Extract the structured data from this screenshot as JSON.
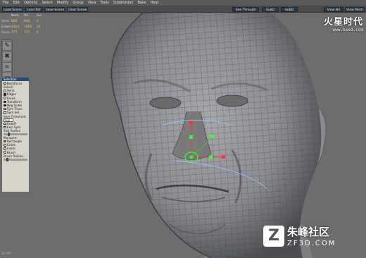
{
  "menu": [
    "File",
    "Edit",
    "Options",
    "Select",
    "Modify",
    "Group",
    "View",
    "Tools",
    "Subdivision",
    "Bake",
    "Help"
  ],
  "toolbar": {
    "load_scene": "Load Scene",
    "load_ref": "Load Ref",
    "save_scene": "Save Scene",
    "clear_scene": "Clear Scene",
    "see_through": "See Through",
    "subd": "SubD",
    "subd_mode": "SubD Mode",
    "view_nrl": "View Nrl",
    "view_mesh": "View Mesh"
  },
  "stats": {
    "headers": [
      "",
      "Num",
      "Vis",
      "Sel"
    ],
    "rows": [
      {
        "label": "Verts",
        "num": "602",
        "vis": "602",
        "sel": "0"
      },
      {
        "label": "Edges",
        "num": "1601",
        "vis": "1601",
        "sel": "24"
      },
      {
        "label": "Faces",
        "num": "777",
        "vis": "777",
        "sel": "6"
      }
    ]
  },
  "tools": [
    "paint-icon",
    "delete-x-icon",
    "link-icon",
    "folder-icon"
  ],
  "panel": {
    "title": "Selection",
    "backfaces": "Backfaces",
    "select_label": "Select:",
    "verts": "Verts",
    "edges": "Edges",
    "faces": "Faces",
    "transform": "Transform",
    "neg_scale": "Neg Scale",
    "sym_trans": "Sym Trans",
    "sym_sel": "Sym Sel",
    "sym_threshold": "Sym Threshold:",
    "threshold_value": "200",
    "falloff": "Falloff",
    "excl_sym": "Excl Sym",
    "soft_radius": "Soft Radius:",
    "marquee": "Marquee:",
    "rectangle": "Rectangle",
    "circle": "Circle",
    "lasso": "Lasso",
    "brush": "Brush",
    "brush_radius": "Brush Radius:"
  },
  "watermark_top": {
    "logo": "火星时代",
    "url": "www.hxsd.com"
  },
  "watermark_bottom": {
    "cn": "朱峰社区",
    "en": "ZF3D.COM",
    "z": "Z"
  },
  "fps": "30 FPS"
}
